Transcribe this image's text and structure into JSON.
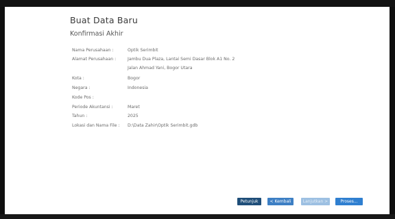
{
  "dialog": {
    "title": "Buat Data Baru",
    "subtitle": "Konfirmasi Akhir"
  },
  "fields": [
    {
      "label": "Nama Perusahaan :",
      "value": "Optik Serimbit"
    },
    {
      "label": "Alamat Perusahaan :",
      "value": "Jambu Dua Plaza, Lantai Semi Dasar Blok A1 No. 2"
    },
    {
      "label": "",
      "value": "Jalan Ahmad Yani, Bogor Utara"
    },
    {
      "label": "Kota :",
      "value": "Bogor"
    },
    {
      "label": "Negara :",
      "value": "Indonesia"
    },
    {
      "label": "Kode Pos :",
      "value": ""
    },
    {
      "label": "Periode Akuntansi :",
      "value": "Maret"
    },
    {
      "label": "Tahun :",
      "value": "2025"
    },
    {
      "label": "Lokasi dan Nama File :",
      "value": "D:\\Data Zahir\\Optik Serimbit.gdb"
    }
  ],
  "buttons": {
    "petunjuk": "Petunjuk",
    "kembali": "< Kembali",
    "lanjutkan": "Lanjutkan >",
    "proses": "Proses..."
  }
}
